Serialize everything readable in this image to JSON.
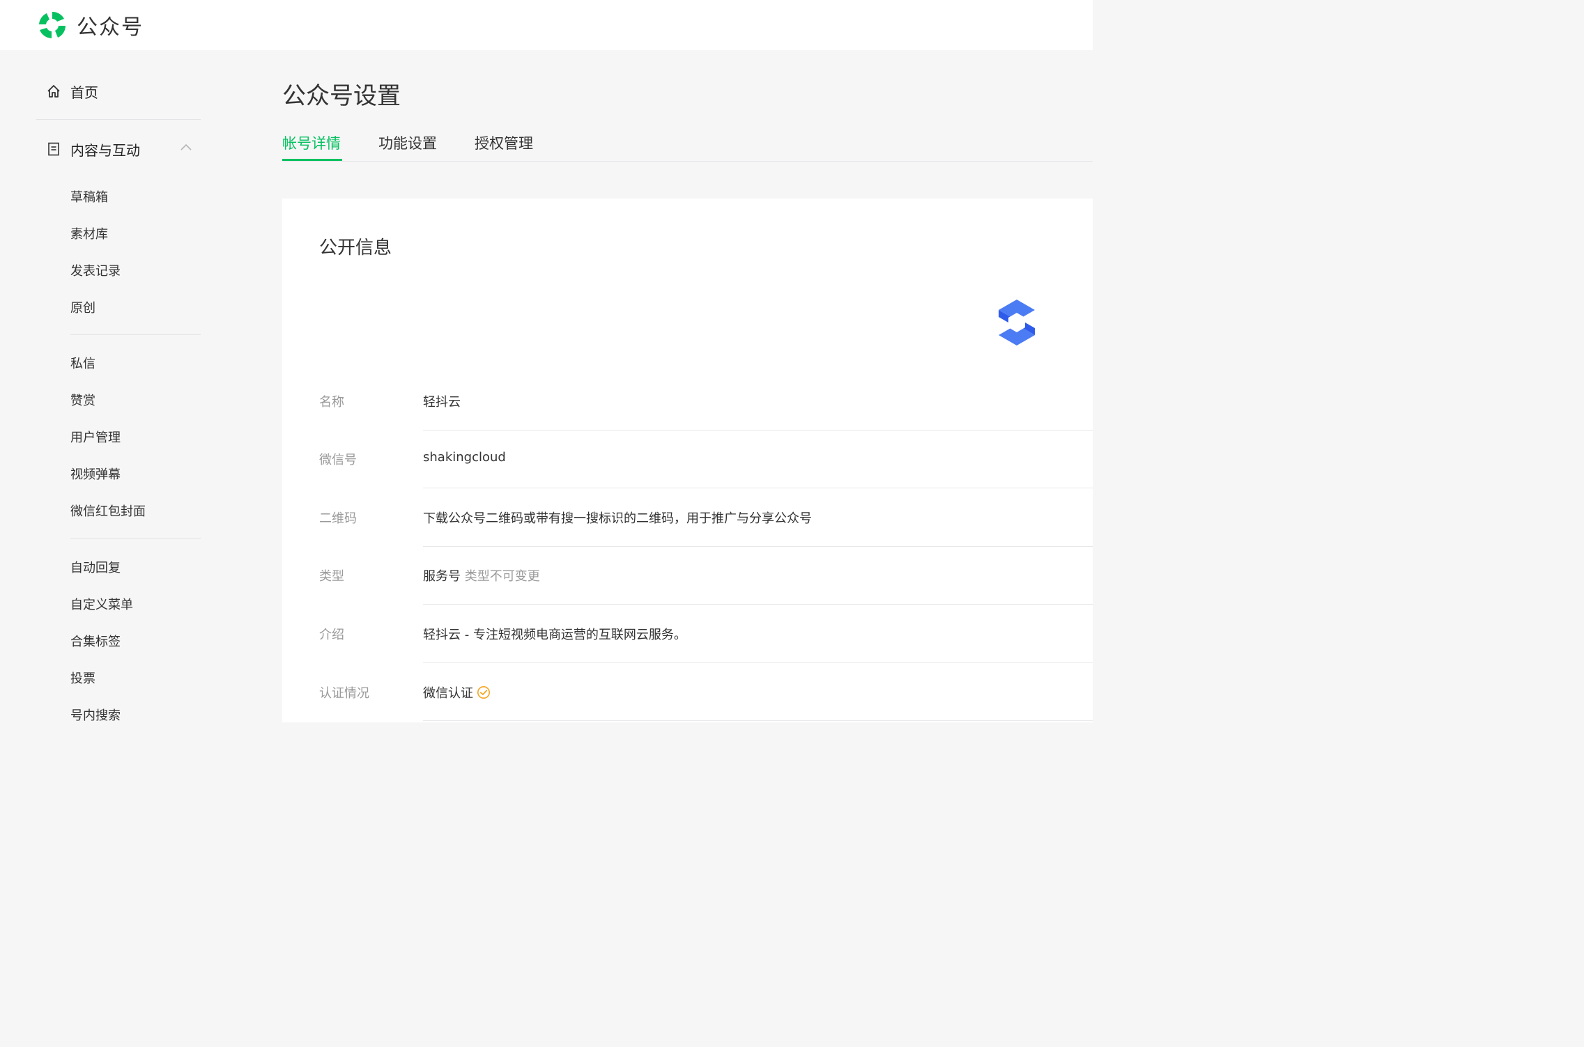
{
  "brand": {
    "name": "公众号"
  },
  "sidebar": {
    "home": "首页",
    "content_group": "内容与互动",
    "items_group1": [
      "草稿箱",
      "素材库",
      "发表记录",
      "原创"
    ],
    "items_group2": [
      "私信",
      "赞赏",
      "用户管理",
      "视频弹幕",
      "微信红包封面"
    ],
    "items_group3": [
      "自动回复",
      "自定义菜单",
      "合集标签",
      "投票",
      "号内搜索"
    ]
  },
  "main": {
    "title": "公众号设置",
    "tabs": [
      "帐号详情",
      "功能设置",
      "授权管理"
    ],
    "active_tab": "帐号详情",
    "section_title": "公开信息",
    "rows": [
      {
        "label": "名称",
        "value": "轻抖云"
      },
      {
        "label": "微信号",
        "value": "shakingcloud"
      },
      {
        "label": "二维码",
        "value": "下载公众号二维码或带有搜一搜标识的二维码，用于推广与分享公众号"
      },
      {
        "label": "类型",
        "value": "服务号",
        "note": "类型不可变更"
      },
      {
        "label": "介绍",
        "value": "轻抖云 - 专注短视频电商运营的互联网云服务。"
      },
      {
        "label": "认证情况",
        "value": "微信认证"
      }
    ]
  },
  "icons": {
    "brand_logo": "wechat-official-account-logo",
    "home": "home-icon",
    "content": "document-icon",
    "caret": "chevron-up-icon",
    "avatar": "shakingcloud-logo",
    "verified": "verified-check-icon"
  },
  "colors": {
    "accent": "#07c160",
    "avatar_blue": "#2f5bea",
    "verified": "#f5a623"
  }
}
